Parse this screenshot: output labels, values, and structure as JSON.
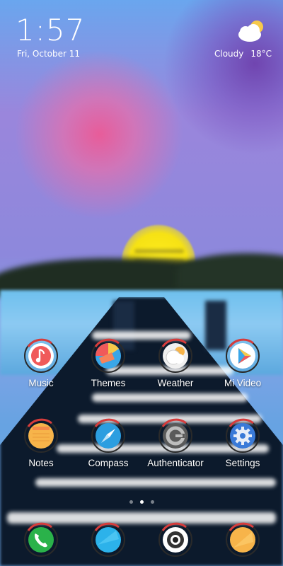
{
  "status": {
    "time": "1:57",
    "date": "Fri, October 11",
    "weather_condition": "Cloudy",
    "weather_temp": "18°C",
    "weather_icon": "cloud-sun-icon"
  },
  "apps_row1": [
    {
      "label": "Music",
      "icon": "music-icon"
    },
    {
      "label": "Themes",
      "icon": "themes-icon"
    },
    {
      "label": "Weather",
      "icon": "weather-icon"
    },
    {
      "label": "Mi Video",
      "icon": "video-play-icon"
    }
  ],
  "apps_row2": [
    {
      "label": "Notes",
      "icon": "notes-icon"
    },
    {
      "label": "Compass",
      "icon": "compass-icon"
    },
    {
      "label": "Authenticator",
      "icon": "authenticator-icon"
    },
    {
      "label": "Settings",
      "icon": "gear-icon"
    }
  ],
  "dock": [
    {
      "icon": "phone-icon"
    },
    {
      "icon": "messaging-icon"
    },
    {
      "icon": "camera-icon"
    },
    {
      "icon": "browser-icon"
    }
  ],
  "page_indicator": {
    "pages": 3,
    "active": 2
  },
  "colors": {
    "music": "#f05a5a",
    "themes_blue": "#3aa6e8",
    "themes_red": "#f05a5a",
    "themes_yellow": "#f7c94a",
    "notes": "#f7b44a",
    "compass": "#2c9ee0",
    "settings": "#3a7ad8",
    "phone": "#2ab24a",
    "browser": "#f7b44a"
  }
}
